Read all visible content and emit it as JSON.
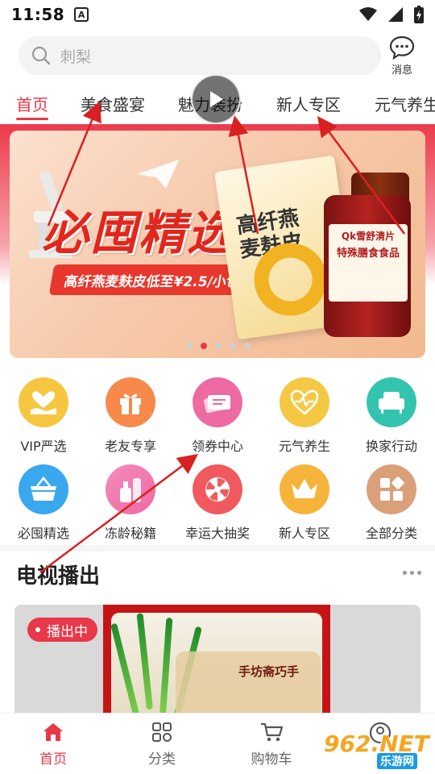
{
  "status_bar": {
    "time": "11:58",
    "notice_letter": "A"
  },
  "search": {
    "placeholder": "刺梨",
    "icon": "search-icon"
  },
  "message": {
    "label": "消息",
    "icon": "chat-bubble-icon"
  },
  "tabs": [
    {
      "label": "首页",
      "active": true
    },
    {
      "label": "美食盛宴",
      "active": false
    },
    {
      "label": "魅力装扮",
      "active": false
    },
    {
      "label": "新人专区",
      "active": false
    },
    {
      "label": "元气养生",
      "active": false
    }
  ],
  "banner": {
    "title": "必囤精选",
    "subtitle": "高纤燕麦麸皮低至¥2.5/小包",
    "product_box_text": "高纤燕麦麸皮",
    "bottle_line1": "Qk雪舒清片",
    "bottle_line2": "特殊膳食食品",
    "slide_count": 5,
    "active_slide": 2
  },
  "quick_links": [
    {
      "label": "VIP严选",
      "icon": "vip-heart-hand-icon",
      "color": "#f7c640"
    },
    {
      "label": "老友专享",
      "icon": "gift-box-icon",
      "color": "#f7894a"
    },
    {
      "label": "领券中心",
      "icon": "coupon-icon",
      "color": "#ee6aa2"
    },
    {
      "label": "元气养生",
      "icon": "heartbeat-icon",
      "color": "#f4c843"
    },
    {
      "label": "换家行动",
      "icon": "sofa-icon",
      "color": "#33c4b0"
    },
    {
      "label": "必囤精选",
      "icon": "basket-icon",
      "color": "#3aa8ee"
    },
    {
      "label": "冻龄秘籍",
      "icon": "cosmetics-icon",
      "color": "#ef6ea8"
    },
    {
      "label": "幸运大抽奖",
      "icon": "lucky-wheel-icon",
      "color": "#f05a5f"
    },
    {
      "label": "新人专区",
      "icon": "crown-icon",
      "color": "#f6b43a"
    },
    {
      "label": "全部分类",
      "icon": "category-grid-icon",
      "color": "#d9a07a"
    }
  ],
  "tv_section": {
    "title": "电视播出",
    "live_badge": "播出中",
    "package_text": "手坊斋巧手"
  },
  "bottom_nav": [
    {
      "label": "首页",
      "icon": "home-icon",
      "active": true
    },
    {
      "label": "分类",
      "icon": "category-icon",
      "active": false
    },
    {
      "label": "购物车",
      "icon": "cart-icon",
      "active": false
    }
  ],
  "watermark": {
    "main": "962.NET",
    "sub": "乐游网"
  },
  "colors": {
    "accent": "#e8384a",
    "banner_red": "#e2261d"
  }
}
